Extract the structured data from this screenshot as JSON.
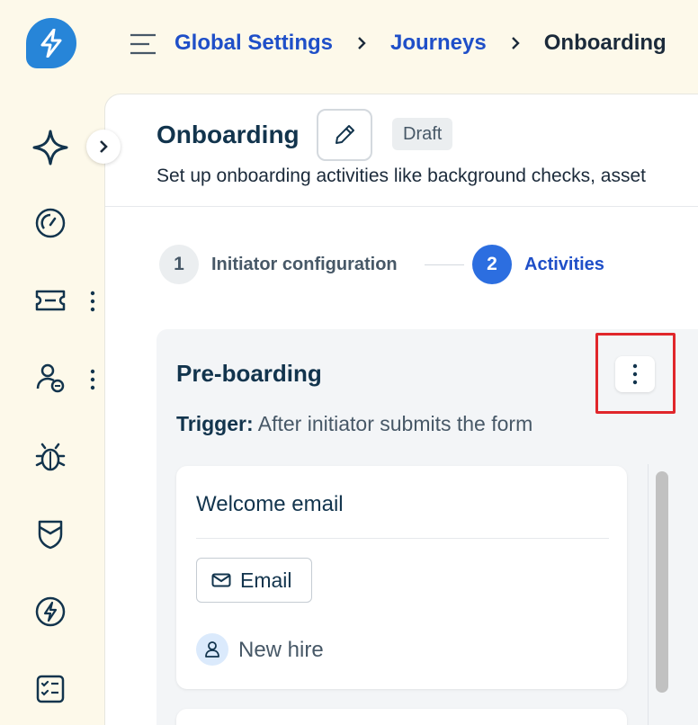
{
  "breadcrumb": {
    "items": [
      "Global Settings",
      "Journeys"
    ],
    "current": "Onboarding"
  },
  "header": {
    "title": "Onboarding",
    "status_badge": "Draft",
    "subtitle": "Set up onboarding activities like background checks, asset"
  },
  "stepper": {
    "steps": [
      {
        "number": "1",
        "label": "Initiator configuration",
        "state": "inactive"
      },
      {
        "number": "2",
        "label": "Activities",
        "state": "active"
      }
    ]
  },
  "stage": {
    "title": "Pre-boarding",
    "trigger_label": "Trigger:",
    "trigger_value": "After initiator submits the form",
    "activities": [
      {
        "title": "Welcome email",
        "type": "Email",
        "assignee": "New hire"
      }
    ]
  },
  "sidebar": {
    "icons": [
      "sparkle-icon",
      "dashboard-gauge-icon",
      "ticket-icon",
      "people-icon",
      "bug-icon",
      "shield-icon",
      "lightning-icon",
      "checklist-icon"
    ]
  },
  "colors": {
    "brand": "#2785d8",
    "link": "#1f4fc8",
    "active_step": "#2c6ee0",
    "highlight": "#e0262b",
    "background": "#fdf9ea"
  }
}
